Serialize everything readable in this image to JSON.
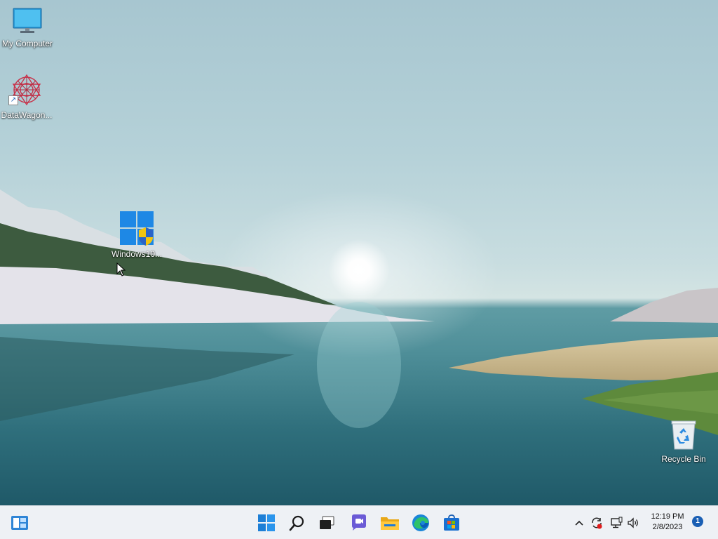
{
  "desktop": {
    "icons": [
      {
        "label": "My Computer",
        "icon": "monitor-icon"
      },
      {
        "label": "DataWagon...",
        "icon": "datawagon-icon"
      },
      {
        "label": "Windows10...",
        "icon": "windows-logo-icon"
      },
      {
        "label": "Recycle Bin",
        "icon": "recycle-bin-icon"
      }
    ]
  },
  "taskbar": {
    "left_widget": "widgets-icon",
    "apps": [
      "start",
      "search",
      "task-view",
      "chat",
      "file-explorer",
      "edge",
      "store"
    ],
    "clock": {
      "time": "12:19 PM",
      "date": "2/8/2023"
    },
    "notification_count": "1"
  }
}
